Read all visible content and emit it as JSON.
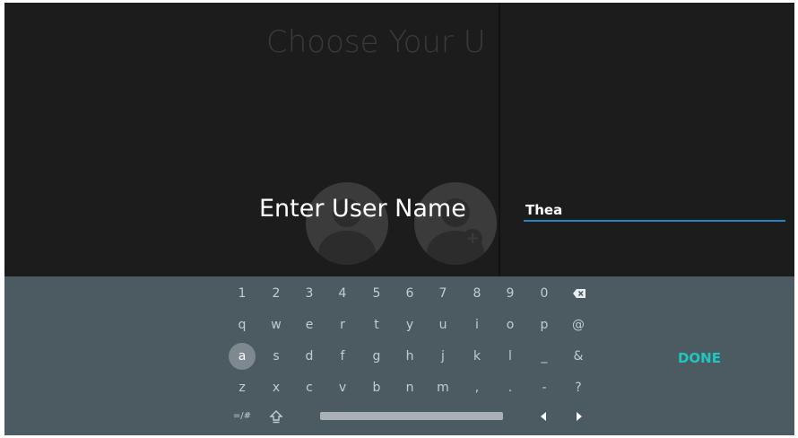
{
  "background": {
    "title": "Choose Your U"
  },
  "prompt": {
    "label": "Enter User Name"
  },
  "input": {
    "value": "Thea"
  },
  "keyboard": {
    "row1": [
      "1",
      "2",
      "3",
      "4",
      "5",
      "6",
      "7",
      "8",
      "9",
      "0"
    ],
    "row2": [
      "q",
      "w",
      "e",
      "r",
      "t",
      "y",
      "u",
      "i",
      "o",
      "p",
      "@"
    ],
    "row3": [
      "a",
      "s",
      "d",
      "f",
      "g",
      "h",
      "j",
      "k",
      "l",
      "_",
      "&"
    ],
    "row4": [
      "z",
      "x",
      "c",
      "v",
      "b",
      "n",
      "m",
      ",",
      ".",
      "-",
      "?"
    ],
    "symbols_label": "=/#",
    "done_label": "DONE",
    "active_key": "a"
  },
  "colors": {
    "keyboard_bg": "#4c5b62",
    "accent_done": "#1fc7c0",
    "input_underline": "#1e88c7"
  },
  "icons": {
    "backspace": "backspace-icon",
    "shift": "shift-icon",
    "left": "arrow-left-icon",
    "right": "arrow-right-icon"
  }
}
